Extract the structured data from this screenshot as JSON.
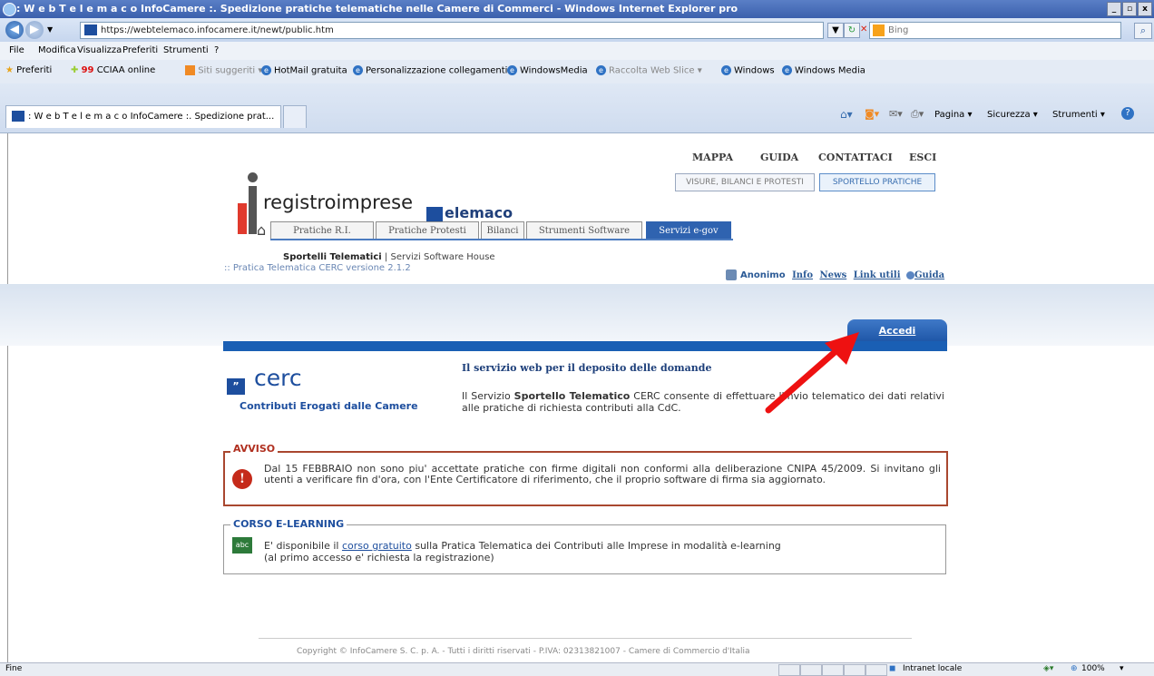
{
  "window": {
    "title": ": W e b T e l e m a c o InfoCamere :. Spedizione pratiche telematiche nelle Camere di Commerci - Windows Internet Explorer pro"
  },
  "address": {
    "url": "https://webtelemaco.infocamere.it/newt/public.htm",
    "search_placeholder": "Bing"
  },
  "menu": [
    "File",
    "Modifica",
    "Visualizza",
    "Preferiti",
    "Strumenti",
    "?"
  ],
  "favorites": {
    "label": "Preferiti",
    "items": [
      "CCIAA online",
      "Siti suggeriti ▾",
      "HotMail gratuita",
      "Personalizzazione collegamenti",
      "WindowsMedia",
      "Raccolta Web Slice ▾",
      "Windows",
      "Windows Media"
    ]
  },
  "tab": {
    "label": ": W e b T e l e m a c o InfoCamere :. Spedizione prat..."
  },
  "commandbar": [
    "Pagina ▾",
    "Sicurezza ▾",
    "Strumenti ▾"
  ],
  "site": {
    "logo": "registroimprese",
    "logo2": "elemaco",
    "top_links": [
      "MAPPA",
      "GUIDA",
      "CONTATTACI",
      "ESCI"
    ],
    "top_buttons": [
      "VISURE, BILANCI E PROTESTI",
      "SPORTELLO PRATICHE"
    ],
    "nav_tabs": [
      "Pratiche R.I.",
      "Pratiche Protesti",
      "Bilanci",
      "Strumenti Software",
      "Servizi e-gov"
    ],
    "sub_active": "Sportelli Telematici",
    "sub_sep": "|",
    "sub_other": "Servizi Software House",
    "breadcrumb": ":: Pratica Telematica CERC versione 2.1.2",
    "user": "Anonimo",
    "util_links": [
      "Info",
      "News",
      "Link utili",
      "Guida"
    ],
    "accedi": "Accedi",
    "cerc_title": "cerc",
    "cerc_subtitle": "Contributi Erogati dalle Camere",
    "service_title": "Il servizio web per il deposito delle domande",
    "service_desc_pre": "Il Servizio ",
    "service_desc_bold": "Sportello Telematico",
    "service_desc_post": " CERC consente di effettuare l'invio telematico dei dati relativi alle pratiche di richiesta contributi alla CdC.",
    "avviso_title": "AVVISO",
    "avviso_text": "Dal 15 FEBBRAIO non sono piu' accettate pratiche con firme digitali non conformi alla deliberazione CNIPA 45/2009. Si invitano gli utenti a verificare fin d'ora, con l'Ente Certificatore di riferimento, che il proprio software di firma sia aggiornato.",
    "corso_title": "CORSO E-LEARNING",
    "corso_pre": "E' disponibile il ",
    "corso_link": "corso gratuito",
    "corso_post": " sulla Pratica Telematica dei Contributi alle Imprese in modalità e-learning",
    "corso_line2": "(al primo accesso e' richiesta la registrazione)",
    "footer": "Copyright © InfoCamere S. C. p. A. - Tutti i diritti riservati - P.IVA: 02313821007 - Camere di Commercio d'Italia"
  },
  "status": {
    "left": "Fine",
    "zone": "Intranet locale",
    "zoom": "100%"
  },
  "colors": {
    "accent": "#1a5fb4",
    "avviso": "#a9472f",
    "arrow": "#ee1111"
  }
}
